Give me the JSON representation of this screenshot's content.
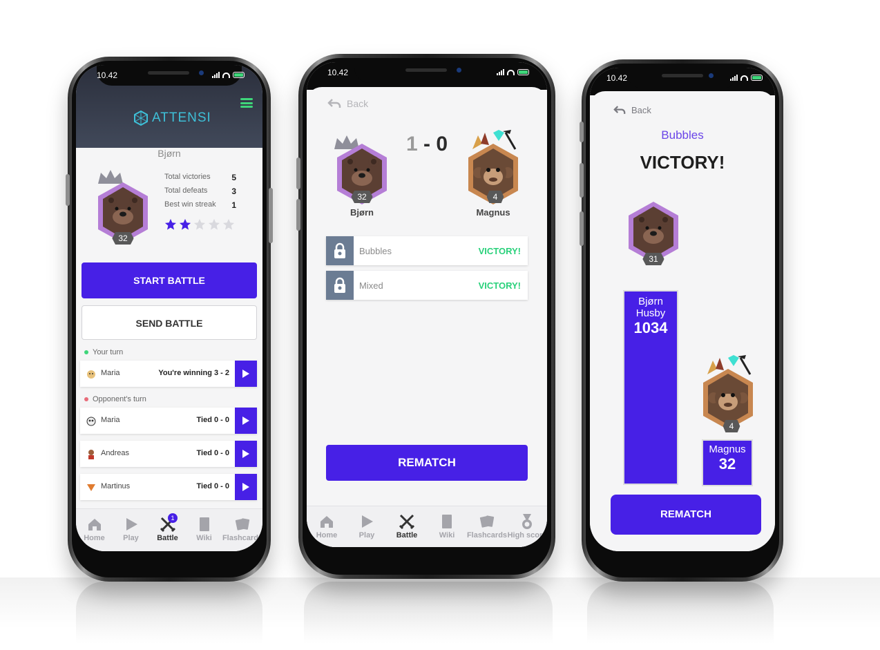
{
  "colors": {
    "accent": "#4720e6",
    "victory": "#2ad17b",
    "brand": "#3ec0d8",
    "avatar_border": "#b57ed6"
  },
  "status_time": "10.42",
  "tabs": [
    {
      "label": "Home",
      "icon": "home-icon"
    },
    {
      "label": "Play",
      "icon": "play-icon"
    },
    {
      "label": "Battle",
      "icon": "battle-swords-icon"
    },
    {
      "label": "Wiki",
      "icon": "book-icon"
    },
    {
      "label": "Flashcards",
      "icon": "flashcards-icon"
    },
    {
      "label": "High score",
      "icon": "medal-icon"
    }
  ],
  "phone1": {
    "brand": "ATTENSI",
    "player_name": "Bjørn",
    "level": "32",
    "stats": [
      {
        "label": "Total victories",
        "value": "5"
      },
      {
        "label": "Total defeats",
        "value": "3"
      },
      {
        "label": "Best win streak",
        "value": "1"
      }
    ],
    "stars_filled": 2,
    "stars_total": 5,
    "start_battle": "START BATTLE",
    "send_battle": "SEND BATTLE",
    "your_turn_label": "Your turn",
    "opponents_turn_label": "Opponent's turn",
    "battle_badge": "1",
    "your_turn": [
      {
        "name": "Maria",
        "status": "You're winning 3 - 2"
      }
    ],
    "opponents_turn": [
      {
        "name": "Maria",
        "status": "Tied 0 - 0"
      },
      {
        "name": "Andreas",
        "status": "Tied 0 - 0"
      },
      {
        "name": "Martinus",
        "status": "Tied 0 - 0"
      }
    ]
  },
  "phone2": {
    "back": "Back",
    "score_left": "1",
    "score_sep": "-",
    "score_right": "0",
    "player1": {
      "name": "Bjørn",
      "level": "32"
    },
    "player2": {
      "name": "Magnus",
      "level": "4"
    },
    "rounds": [
      {
        "category": "Bubbles",
        "result": "VICTORY!"
      },
      {
        "category": "Mixed",
        "result": "VICTORY!"
      }
    ],
    "rematch": "REMATCH"
  },
  "phone3": {
    "back": "Back",
    "category": "Bubbles",
    "headline": "VICTORY!",
    "winner": {
      "name": "Bjørn Husby",
      "score": "1034",
      "level": "31"
    },
    "loser": {
      "name": "Magnus",
      "score": "32",
      "level": "4"
    },
    "rematch": "REMATCH"
  }
}
